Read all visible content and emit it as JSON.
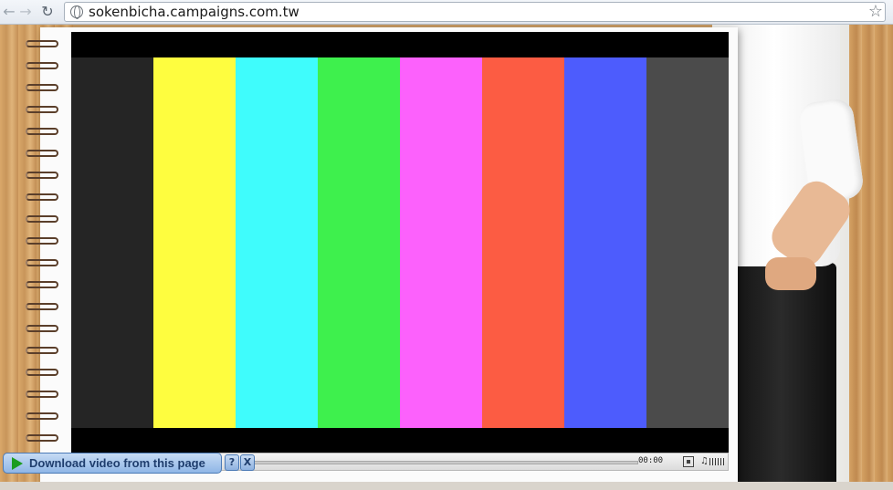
{
  "browser": {
    "url": "sokenbicha.campaigns.com.tw",
    "icons": {
      "back": "back-arrow-icon",
      "forward": "forward-arrow-icon",
      "reload": "reload-icon",
      "site": "globe-icon",
      "bookmark": "star-icon"
    }
  },
  "video": {
    "color_bars": [
      "#252525",
      "#fefd3f",
      "#3ffcfc",
      "#3ef04d",
      "#fc61fc",
      "#fc5c43",
      "#4d5cfd",
      "#4b4b4b"
    ],
    "time": "00:00"
  },
  "download_bar": {
    "label": "Download video from this page",
    "help_label": "?",
    "close_label": "X"
  }
}
